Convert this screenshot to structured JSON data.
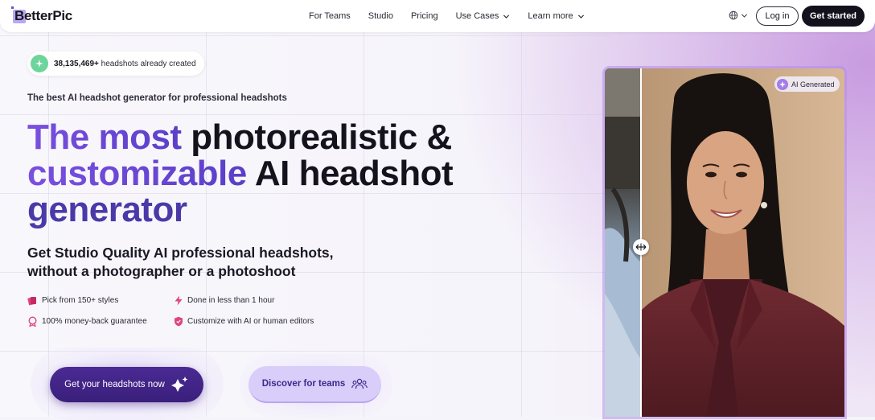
{
  "nav": {
    "logo_text": "BetterPic",
    "items": [
      {
        "label": "For Teams",
        "dropdown": false
      },
      {
        "label": "Studio",
        "dropdown": false
      },
      {
        "label": "Pricing",
        "dropdown": false
      },
      {
        "label": "Use Cases",
        "dropdown": true
      },
      {
        "label": "Learn more",
        "dropdown": true
      }
    ],
    "login_label": "Log in",
    "get_started_label": "Get started"
  },
  "hero": {
    "counter_number": "38,135,469+",
    "counter_suffix": " headshots already created",
    "tagline": "The best AI headshot generator for professional headshots",
    "headline_line1_grad": "The most",
    "headline_line1_rest": " photorealistic &",
    "headline_line2_grad": "customizable",
    "headline_line2_rest": " AI headshot",
    "headline_line3": "generator",
    "subheading_line1": "Get Studio Quality AI professional headshots,",
    "subheading_line2": "without a photographer or a photoshoot",
    "features": [
      {
        "label": "Pick from 150+ styles",
        "icon": "styles-icon"
      },
      {
        "label": "Done in less than 1 hour",
        "icon": "lightning-icon"
      },
      {
        "label": "100% money-back guarantee",
        "icon": "badge-icon"
      },
      {
        "label": "Customize with AI or human editors",
        "icon": "shield-icon"
      }
    ],
    "cta_primary": "Get your headshots now",
    "cta_secondary": "Discover for teams"
  },
  "compare": {
    "badge_label": "AI Generated"
  },
  "colors": {
    "accent_purple": "#5a3fc8",
    "cta_dark": "#3a1f7b",
    "cta_light": "#d9cdfa",
    "nav_button_dark": "#12111c"
  }
}
